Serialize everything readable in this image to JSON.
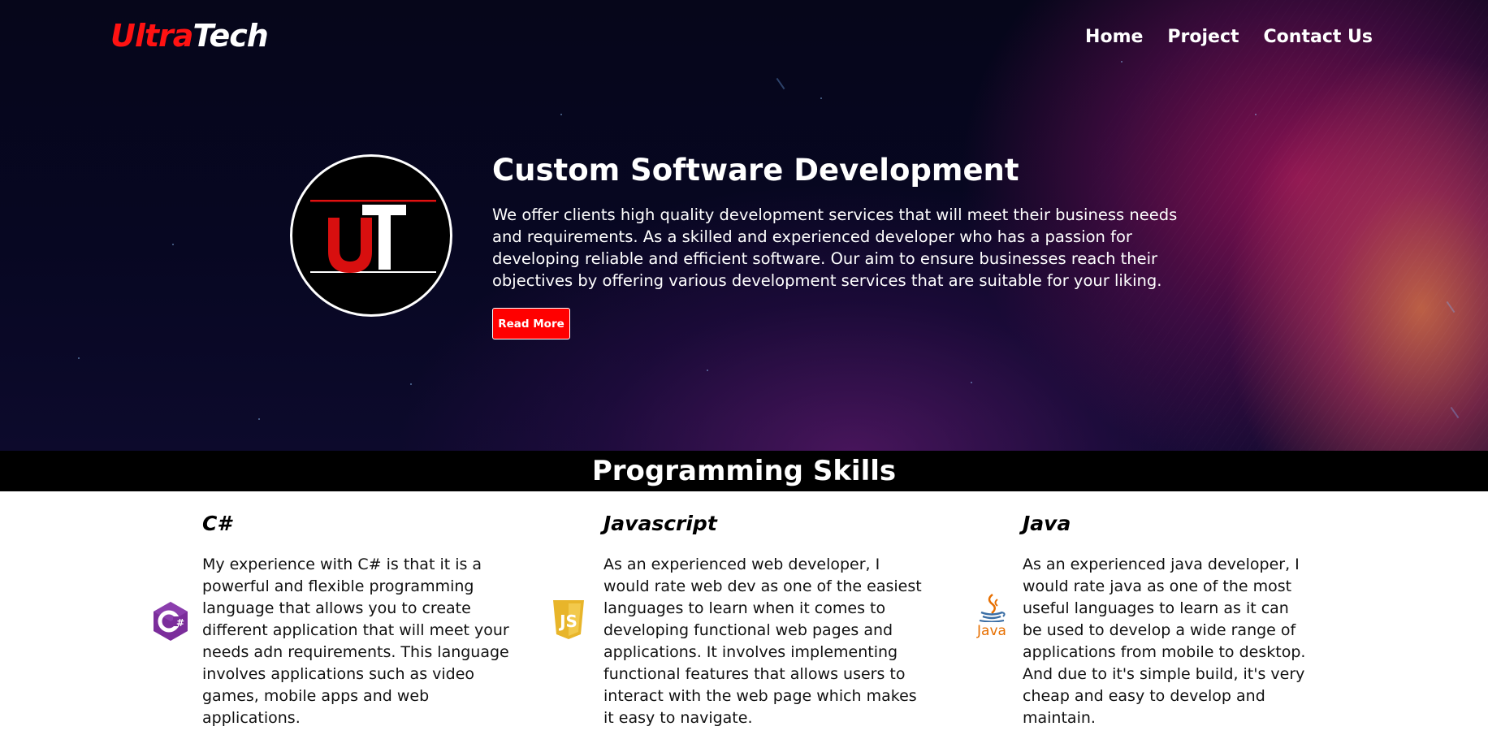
{
  "brand": {
    "part1": "Ultra",
    "part2": "Tech"
  },
  "nav": {
    "items": [
      "Home",
      "Project",
      "Contact Us"
    ]
  },
  "hero": {
    "emblem_text": "UT",
    "title": "Custom Software Development",
    "description": "We offer clients high quality development services that will meet their business needs and requirements. As a skilled and experienced developer who has a passion for developing reliable and efficient software. Our aim to ensure businesses reach their objectives by offering various development services that are suitable for your liking.",
    "button_label": "Read More"
  },
  "skills": {
    "heading": "Programming Skills",
    "items": [
      {
        "title": "C#",
        "icon": "csharp-icon",
        "text": "My experience with C# is that it is a powerful and flexible programming language that allows you to create different application that will meet your needs adn requirements. This language involves applications such as video games, mobile apps and web applications."
      },
      {
        "title": "Javascript",
        "icon": "javascript-icon",
        "text": "As an experienced web developer, I would rate web dev as one of the easiest languages to learn when it comes to developing functional web pages and applications. It involves implementing functional features that allows users to interact with the web page which makes it easy to navigate."
      },
      {
        "title": "Java",
        "icon": "java-icon",
        "icon_label": "Java",
        "text": "As an experienced java developer, I would rate java as one of the most useful languages to learn as it can be used to develop a wide range of applications from mobile to desktop. And due to it's simple build, it's very cheap and easy to develop and maintain."
      }
    ]
  },
  "colors": {
    "accent": "#ff0000",
    "bar": "#000000",
    "csharp": "#7b2d9b",
    "javascript": "#e8b52a",
    "java": "#e76f00",
    "java_blue": "#3a6ea5"
  }
}
